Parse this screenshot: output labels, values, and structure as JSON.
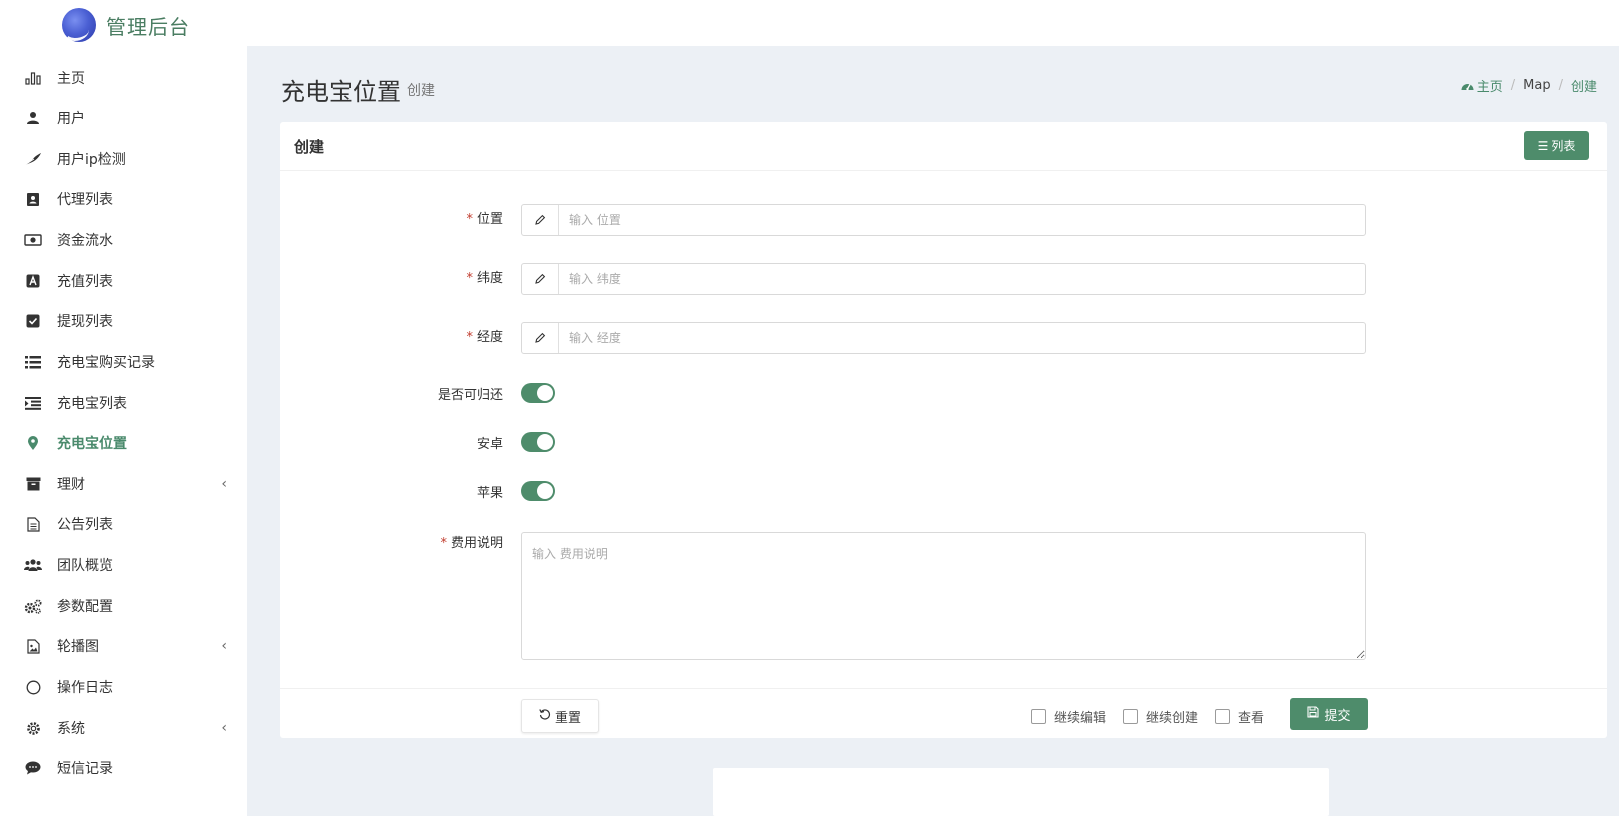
{
  "app": {
    "brand": "管理后台"
  },
  "sidebar": {
    "items": [
      {
        "label": "主页",
        "icon": "bar-chart-icon"
      },
      {
        "label": "用户",
        "icon": "user-icon"
      },
      {
        "label": "用户ip检测",
        "icon": "feather-icon"
      },
      {
        "label": "代理列表",
        "icon": "address-book-icon"
      },
      {
        "label": "资金流水",
        "icon": "money-icon"
      },
      {
        "label": "充值列表",
        "icon": "letter-a-icon"
      },
      {
        "label": "提现列表",
        "icon": "check-square-icon"
      },
      {
        "label": "充电宝购买记录",
        "icon": "list-icon"
      },
      {
        "label": "充电宝列表",
        "icon": "indent-list-icon"
      },
      {
        "label": "充电宝位置",
        "icon": "map-pin-icon",
        "active": true
      },
      {
        "label": "理财",
        "icon": "archive-icon",
        "has_children": true
      },
      {
        "label": "公告列表",
        "icon": "file-text-icon"
      },
      {
        "label": "团队概览",
        "icon": "users-icon"
      },
      {
        "label": "参数配置",
        "icon": "cogs-icon"
      },
      {
        "label": "轮播图",
        "icon": "image-file-icon",
        "has_children": true
      },
      {
        "label": "操作日志",
        "icon": "circle-icon"
      },
      {
        "label": "系统",
        "icon": "gear-icon",
        "has_children": true
      },
      {
        "label": "短信记录",
        "icon": "comment-icon"
      }
    ]
  },
  "header": {
    "title": "充电宝位置",
    "subtitle": "创建",
    "breadcrumb": {
      "home": "主页",
      "section": "Map",
      "current": "创建"
    }
  },
  "card": {
    "title": "创建",
    "list_button": "列表"
  },
  "form": {
    "location": {
      "label": "位置",
      "placeholder": "输入 位置",
      "value": ""
    },
    "latitude": {
      "label": "纬度",
      "placeholder": "输入 纬度",
      "value": ""
    },
    "longitude": {
      "label": "经度",
      "placeholder": "输入 经度",
      "value": ""
    },
    "returnable": {
      "label": "是否可归还",
      "checked": true
    },
    "android": {
      "label": "安卓",
      "checked": true
    },
    "apple": {
      "label": "苹果",
      "checked": true
    },
    "fee_desc": {
      "label": "费用说明",
      "placeholder": "输入 费用说明",
      "value": ""
    }
  },
  "footer": {
    "reset": "重置",
    "continue_edit": "继续编辑",
    "continue_create": "继续创建",
    "view": "查看",
    "submit": "提交"
  },
  "colors": {
    "accent": "#4e8c6b",
    "required": "#c0392b",
    "background": "#ecf0f5"
  }
}
